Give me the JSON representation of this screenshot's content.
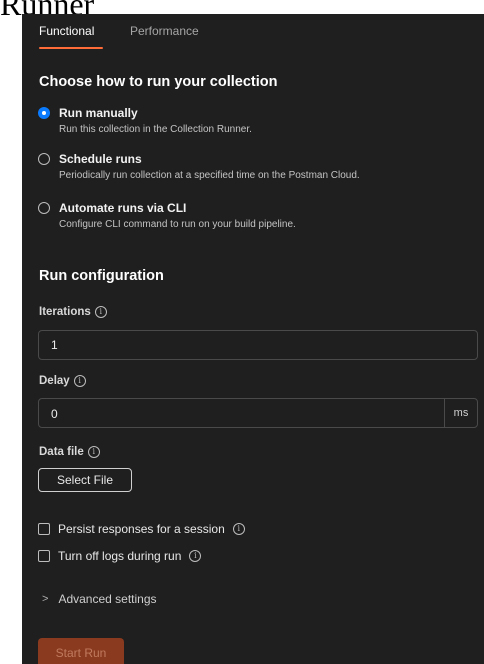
{
  "page": {
    "title": "Runner"
  },
  "tabs": [
    {
      "label": "Functional",
      "active": true
    },
    {
      "label": "Performance",
      "active": false
    }
  ],
  "run_mode": {
    "heading": "Choose how to run your collection",
    "options": [
      {
        "label": "Run manually",
        "description": "Run this collection in the Collection Runner.",
        "selected": true
      },
      {
        "label": "Schedule runs",
        "description": "Periodically run collection at a specified time on the Postman Cloud.",
        "selected": false
      },
      {
        "label": "Automate runs via CLI",
        "description": "Configure CLI command to run on your build pipeline.",
        "selected": false
      }
    ]
  },
  "config": {
    "heading": "Run configuration",
    "iterations": {
      "label": "Iterations",
      "value": "1"
    },
    "delay": {
      "label": "Delay",
      "value": "0",
      "unit": "ms"
    },
    "data_file": {
      "label": "Data file",
      "button_label": "Select File"
    },
    "persist_responses": {
      "label": "Persist responses for a session",
      "checked": false
    },
    "turn_off_logs": {
      "label": "Turn off logs during run",
      "checked": false
    },
    "advanced_label": "Advanced settings"
  },
  "actions": {
    "start_label": "Start Run"
  },
  "icons": {
    "info": "info-icon",
    "chevron": "chevron-right-icon"
  },
  "colors": {
    "accent": "#ff6c37",
    "radio_selected": "#0a7bff",
    "panel_bg": "#1f1f1f",
    "start_button": "#8a3a1f"
  }
}
